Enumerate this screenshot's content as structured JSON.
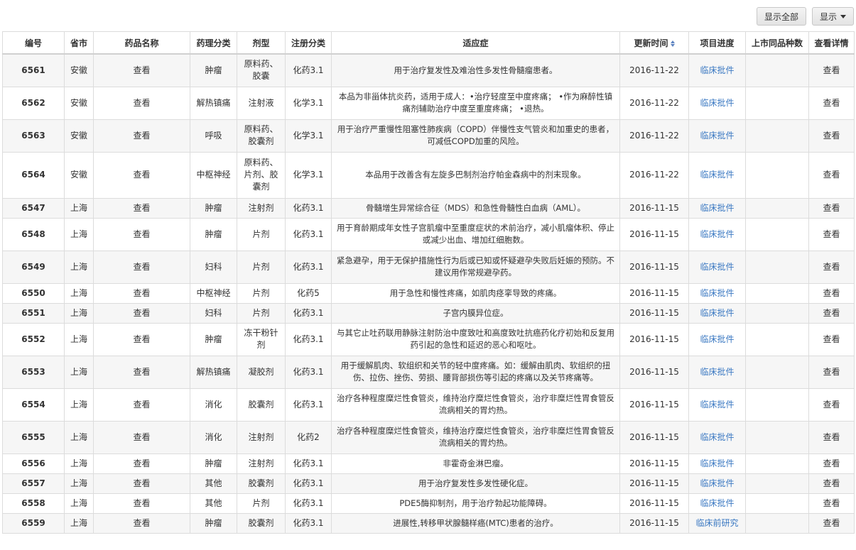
{
  "toolbar": {
    "show_all_label": "显示全部",
    "show_label": "显示"
  },
  "table": {
    "columns": [
      "编号",
      "省市",
      "药品名称",
      "药理分类",
      "剂型",
      "注册分类",
      "适应症",
      "更新时间",
      "项目进度",
      "上市同品种数",
      "查看详情"
    ],
    "rows": [
      {
        "id": "6561",
        "province": "安徽",
        "drug": "查看",
        "class": "肿瘤",
        "form": "原料药、胶囊",
        "reg": "化药3.1",
        "indication": "用于治疗复发性及难治性多发性骨髓瘤患者。",
        "date": "2016-11-22",
        "progress": "临床批件",
        "count": "",
        "detail": "查看"
      },
      {
        "id": "6562",
        "province": "安徽",
        "drug": "查看",
        "class": "解热镇痛",
        "form": "注射液",
        "reg": "化学3.1",
        "indication": "本品为非甾体抗炎药，适用于成人：•治疗轻度至中度疼痛； •作为麻醉性镇痛剂辅助治疗中度至重度疼痛； •退热。",
        "date": "2016-11-22",
        "progress": "临床批件",
        "count": "",
        "detail": "查看"
      },
      {
        "id": "6563",
        "province": "安徽",
        "drug": "查看",
        "class": "呼吸",
        "form": "原料药、胶囊剂",
        "reg": "化学3.1",
        "indication": "用于治疗严重慢性阻塞性肺疾病（COPD）伴慢性支气管炎和加重史的患者，可减低COPD加重的风险。",
        "date": "2016-11-22",
        "progress": "临床批件",
        "count": "",
        "detail": "查看"
      },
      {
        "id": "6564",
        "province": "安徽",
        "drug": "查看",
        "class": "中枢神经",
        "form": "原料药、片剂、胶囊剂",
        "reg": "化学3.1",
        "indication": "本品用于改善含有左旋多巴制剂治疗帕金森病中的剂末现象。",
        "date": "2016-11-22",
        "progress": "临床批件",
        "count": "",
        "detail": "查看"
      },
      {
        "id": "6547",
        "province": "上海",
        "drug": "查看",
        "class": "肿瘤",
        "form": "注射剂",
        "reg": "化药3.1",
        "indication": "骨髓增生异常综合征（MDS）和急性骨髓性白血病（AML）。",
        "date": "2016-11-15",
        "progress": "临床批件",
        "count": "",
        "detail": "查看"
      },
      {
        "id": "6548",
        "province": "上海",
        "drug": "查看",
        "class": "肿瘤",
        "form": "片剂",
        "reg": "化药3.1",
        "indication": "用于育龄期成年女性子宫肌瘤中至重度症状的术前治疗，减小肌瘤体积、停止或减少出血、增加红细胞数。",
        "date": "2016-11-15",
        "progress": "临床批件",
        "count": "",
        "detail": "查看"
      },
      {
        "id": "6549",
        "province": "上海",
        "drug": "查看",
        "class": "妇科",
        "form": "片剂",
        "reg": "化药3.1",
        "indication": "紧急避孕，用于无保护措施性行为后或已知或怀疑避孕失败后妊娠的预防。不建议用作常规避孕药。",
        "date": "2016-11-15",
        "progress": "临床批件",
        "count": "",
        "detail": "查看"
      },
      {
        "id": "6550",
        "province": "上海",
        "drug": "查看",
        "class": "中枢神经",
        "form": "片剂",
        "reg": "化药5",
        "indication": "用于急性和慢性疼痛，如肌肉痉挛导致的疼痛。",
        "date": "2016-11-15",
        "progress": "临床批件",
        "count": "",
        "detail": "查看"
      },
      {
        "id": "6551",
        "province": "上海",
        "drug": "查看",
        "class": "妇科",
        "form": "片剂",
        "reg": "化药3.1",
        "indication": "子宫内膜异位症。",
        "date": "2016-11-15",
        "progress": "临床批件",
        "count": "",
        "detail": "查看"
      },
      {
        "id": "6552",
        "province": "上海",
        "drug": "查看",
        "class": "肿瘤",
        "form": "冻干粉针剂",
        "reg": "化药3.1",
        "indication": "与其它止吐药联用静脉注射防治中度致吐和高度致吐抗癌药化疗初始和反复用药引起的急性和延迟的恶心和呕吐。",
        "date": "2016-11-15",
        "progress": "临床批件",
        "count": "",
        "detail": "查看"
      },
      {
        "id": "6553",
        "province": "上海",
        "drug": "查看",
        "class": "解热镇痛",
        "form": "凝胶剂",
        "reg": "化药3.1",
        "indication": "用于缓解肌肉、软组织和关节的轻中度疼痛。如：缓解由肌肉、软组织的扭伤、拉伤、挫伤、劳损、腰背部损伤等引起的疼痛以及关节疼痛等。",
        "date": "2016-11-15",
        "progress": "临床批件",
        "count": "",
        "detail": "查看"
      },
      {
        "id": "6554",
        "province": "上海",
        "drug": "查看",
        "class": "消化",
        "form": "胶囊剂",
        "reg": "化药3.1",
        "indication": "治疗各种程度糜烂性食管炎，维持治疗糜烂性食管炎，治疗非糜烂性胃食管反流病相关的胃灼热。",
        "date": "2016-11-15",
        "progress": "临床批件",
        "count": "",
        "detail": "查看"
      },
      {
        "id": "6555",
        "province": "上海",
        "drug": "查看",
        "class": "消化",
        "form": "注射剂",
        "reg": "化药2",
        "indication": "治疗各种程度糜烂性食管炎，维持治疗糜烂性食管炎，治疗非糜烂性胃食管反流病相关的胃灼热。",
        "date": "2016-11-15",
        "progress": "临床批件",
        "count": "",
        "detail": "查看"
      },
      {
        "id": "6556",
        "province": "上海",
        "drug": "查看",
        "class": "肿瘤",
        "form": "注射剂",
        "reg": "化药3.1",
        "indication": "非霍奇金淋巴瘤。",
        "date": "2016-11-15",
        "progress": "临床批件",
        "count": "",
        "detail": "查看"
      },
      {
        "id": "6557",
        "province": "上海",
        "drug": "查看",
        "class": "其他",
        "form": "胶囊剂",
        "reg": "化药3.1",
        "indication": "用于治疗复发性多发性硬化症。",
        "date": "2016-11-15",
        "progress": "临床批件",
        "count": "",
        "detail": "查看"
      },
      {
        "id": "6558",
        "province": "上海",
        "drug": "查看",
        "class": "其他",
        "form": "片剂",
        "reg": "化药3.1",
        "indication": "PDE5酶抑制剂，用于治疗勃起功能障碍。",
        "date": "2016-11-15",
        "progress": "临床批件",
        "count": "",
        "detail": "查看"
      },
      {
        "id": "6559",
        "province": "上海",
        "drug": "查看",
        "class": "肿瘤",
        "form": "胶囊剂",
        "reg": "化药3.1",
        "indication": "进展性,转移甲状腺髓样癌(MTC)患者的治疗。",
        "date": "2016-11-15",
        "progress": "临床前研究",
        "count": "",
        "detail": "查看"
      }
    ]
  }
}
